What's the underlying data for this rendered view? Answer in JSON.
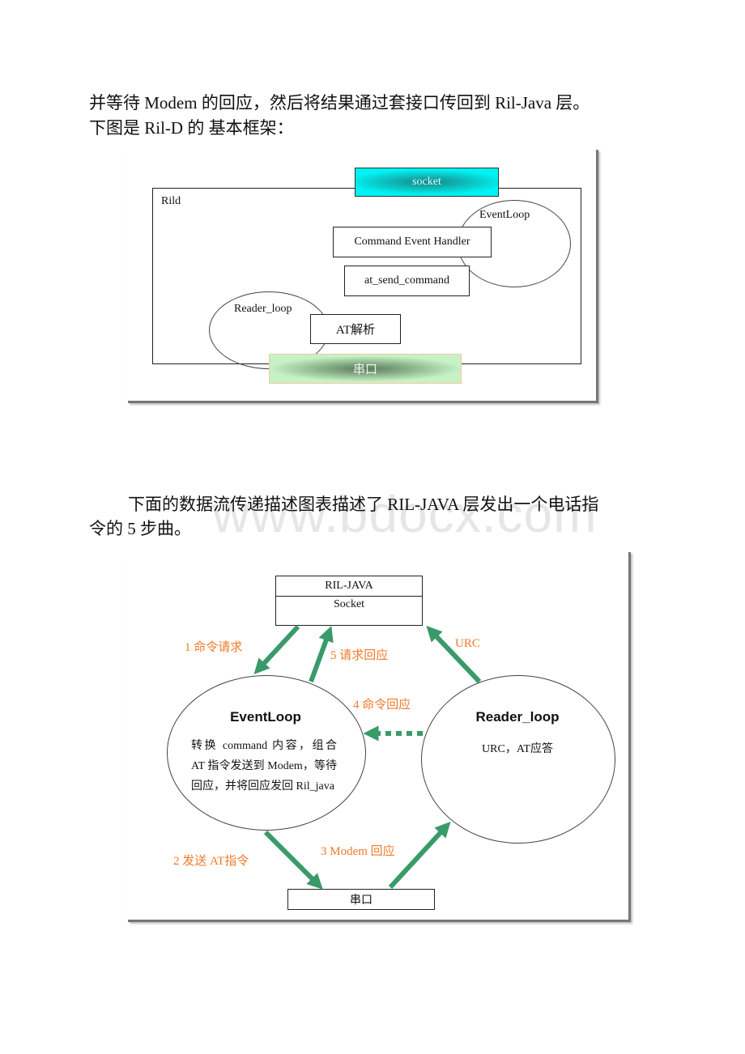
{
  "document": {
    "paragraph1_line1": "并等待 Modem 的回应，然后将结果通过套接口传回到 Ril-Java 层。",
    "paragraph1_line2": "下图是 Ril-D 的 基本框架：",
    "paragraph2_line1": "下面的数据流传递描述图表描述了 RIL-JAVA 层发出一个电话指",
    "paragraph2_line2": "令的 5 步曲。",
    "watermark": "www.bdocx.com"
  },
  "figure1": {
    "container_label": "Rild",
    "socket_label": "socket",
    "eventloop_label": "EventLoop",
    "command_handler_label": "Command Event Handler",
    "at_send_label": "at_send_command",
    "reader_loop_label": "Reader_loop",
    "at_parse_label": "AT解析",
    "serial_label": "串口",
    "colors": {
      "socket": "#00f2f2",
      "serial": "#c6f2c6"
    }
  },
  "figure2": {
    "ril_java_label": "RIL-JAVA",
    "socket_label": "Socket",
    "eventloop_title": "EventLoop",
    "eventloop_desc": "转换 command 内容，组合 AT 指令发送到 Modem，等待回应，并将回应发回 Ril_java",
    "reader_loop_title": "Reader_loop",
    "reader_loop_desc": "URC，AT应答",
    "serial_label": "串口",
    "steps": {
      "step1": "1 命令请求",
      "step2": "2  发送 AT指令",
      "step3": "3 Modem 回应",
      "step4": "4  命令回应",
      "step5": "5  请求回应",
      "urc": "URC"
    },
    "colors": {
      "arrow": "#3a9a6a",
      "step_label": "#f07a2a"
    }
  }
}
